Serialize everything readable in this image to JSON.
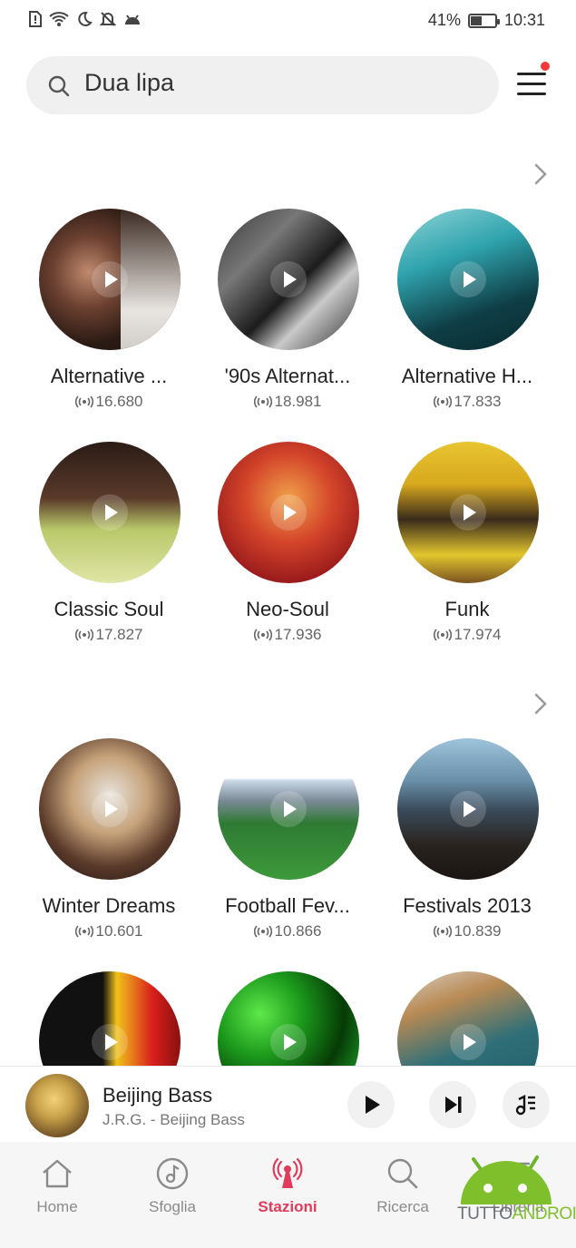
{
  "status_bar": {
    "battery": "41%",
    "time": "10:31"
  },
  "search": {
    "query": "Dua lipa"
  },
  "sections": [
    {
      "stations": [
        {
          "title": "Alternative ...",
          "listeners": "16.680"
        },
        {
          "title": "'90s Alternat...",
          "listeners": "18.981"
        },
        {
          "title": "Alternative H...",
          "listeners": "17.833"
        },
        {
          "title": "Classic Soul",
          "listeners": "17.827"
        },
        {
          "title": "Neo-Soul",
          "listeners": "17.936"
        },
        {
          "title": "Funk",
          "listeners": "17.974"
        }
      ]
    },
    {
      "stations": [
        {
          "title": "Winter Dreams",
          "listeners": "10.601"
        },
        {
          "title": "Football Fev...",
          "listeners": "10.866"
        },
        {
          "title": "Festivals 2013",
          "listeners": "10.839"
        }
      ]
    }
  ],
  "player": {
    "title": "Beijing Bass",
    "subtitle": "J.R.G. - Beijing Bass"
  },
  "nav": {
    "items": [
      {
        "label": "Home"
      },
      {
        "label": "Sfoglia"
      },
      {
        "label": "Stazioni"
      },
      {
        "label": "Ricerca"
      },
      {
        "label": "Libreria"
      }
    ],
    "active": "Stazioni"
  },
  "watermark": {
    "part1": "TUTTO",
    "part2": "ANDROID"
  },
  "colors": {
    "accent": "#e23a5a",
    "notification_dot": "#f0393c",
    "watermark_green": "#7fbf2c"
  }
}
